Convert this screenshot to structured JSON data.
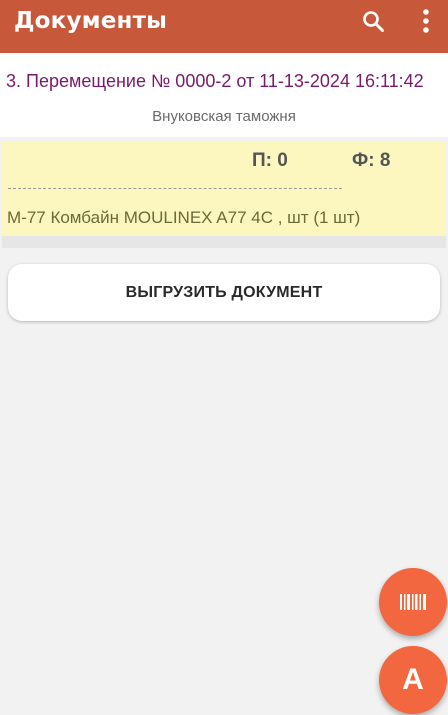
{
  "app_bar": {
    "title": "Документы",
    "search_icon": "search-icon",
    "menu_icon": "more-vert-icon",
    "color": "#c8583a"
  },
  "document": {
    "title": "3. Перемещение № 0000-2 от 11-13-2024 16:11:42",
    "subtitle": "Внуковская таможня"
  },
  "item": {
    "count_p": "П: 0",
    "count_f": "Ф: 8",
    "description": "М-77 Комбайн MOULINEX A77 4C , шт (1 шт)",
    "background": "#fbf7bf"
  },
  "actions": {
    "upload_label": "ВЫГРУЗИТЬ ДОКУМЕНТ"
  },
  "fabs": {
    "barcode_icon": "barcode-icon",
    "a_label": "A",
    "color": "#f2673f"
  }
}
